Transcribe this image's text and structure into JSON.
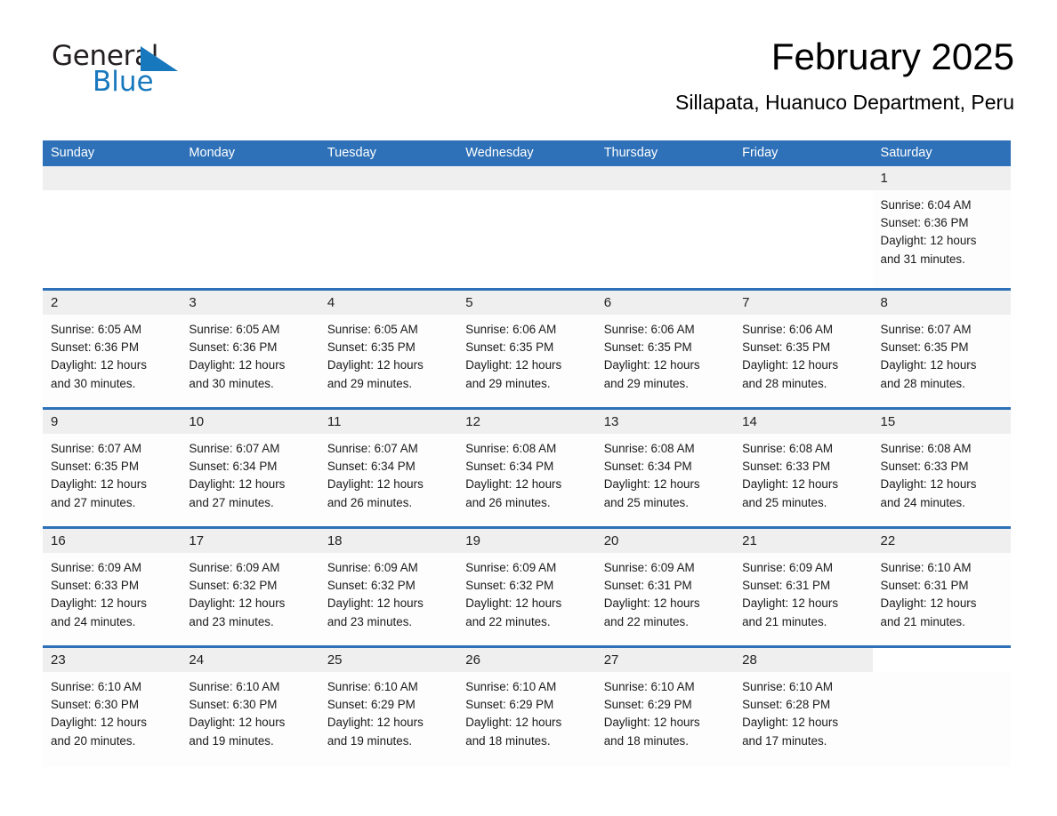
{
  "brand": {
    "name_part1": "General",
    "name_part2": "Blue",
    "accent_color": "#1878be"
  },
  "header": {
    "title": "February 2025",
    "subtitle": "Sillapata, Huanuco Department, Peru"
  },
  "theme": {
    "header_bar_color": "#2e71b8",
    "daynum_band_color": "#efefef",
    "separator_color": "#2e71b8"
  },
  "weekdays": [
    "Sunday",
    "Monday",
    "Tuesday",
    "Wednesday",
    "Thursday",
    "Friday",
    "Saturday"
  ],
  "labels": {
    "sunrise_prefix": "Sunrise:",
    "sunset_prefix": "Sunset:",
    "daylight_prefix": "Daylight:"
  },
  "weeks": [
    [
      {
        "blank": true
      },
      {
        "blank": true
      },
      {
        "blank": true
      },
      {
        "blank": true
      },
      {
        "blank": true
      },
      {
        "blank": true
      },
      {
        "day": "1",
        "sunrise": "Sunrise: 6:04 AM",
        "sunset": "Sunset: 6:36 PM",
        "daylight_l1": "Daylight: 12 hours",
        "daylight_l2": "and 31 minutes."
      }
    ],
    [
      {
        "day": "2",
        "sunrise": "Sunrise: 6:05 AM",
        "sunset": "Sunset: 6:36 PM",
        "daylight_l1": "Daylight: 12 hours",
        "daylight_l2": "and 30 minutes."
      },
      {
        "day": "3",
        "sunrise": "Sunrise: 6:05 AM",
        "sunset": "Sunset: 6:36 PM",
        "daylight_l1": "Daylight: 12 hours",
        "daylight_l2": "and 30 minutes."
      },
      {
        "day": "4",
        "sunrise": "Sunrise: 6:05 AM",
        "sunset": "Sunset: 6:35 PM",
        "daylight_l1": "Daylight: 12 hours",
        "daylight_l2": "and 29 minutes."
      },
      {
        "day": "5",
        "sunrise": "Sunrise: 6:06 AM",
        "sunset": "Sunset: 6:35 PM",
        "daylight_l1": "Daylight: 12 hours",
        "daylight_l2": "and 29 minutes."
      },
      {
        "day": "6",
        "sunrise": "Sunrise: 6:06 AM",
        "sunset": "Sunset: 6:35 PM",
        "daylight_l1": "Daylight: 12 hours",
        "daylight_l2": "and 29 minutes."
      },
      {
        "day": "7",
        "sunrise": "Sunrise: 6:06 AM",
        "sunset": "Sunset: 6:35 PM",
        "daylight_l1": "Daylight: 12 hours",
        "daylight_l2": "and 28 minutes."
      },
      {
        "day": "8",
        "sunrise": "Sunrise: 6:07 AM",
        "sunset": "Sunset: 6:35 PM",
        "daylight_l1": "Daylight: 12 hours",
        "daylight_l2": "and 28 minutes."
      }
    ],
    [
      {
        "day": "9",
        "sunrise": "Sunrise: 6:07 AM",
        "sunset": "Sunset: 6:35 PM",
        "daylight_l1": "Daylight: 12 hours",
        "daylight_l2": "and 27 minutes."
      },
      {
        "day": "10",
        "sunrise": "Sunrise: 6:07 AM",
        "sunset": "Sunset: 6:34 PM",
        "daylight_l1": "Daylight: 12 hours",
        "daylight_l2": "and 27 minutes."
      },
      {
        "day": "11",
        "sunrise": "Sunrise: 6:07 AM",
        "sunset": "Sunset: 6:34 PM",
        "daylight_l1": "Daylight: 12 hours",
        "daylight_l2": "and 26 minutes."
      },
      {
        "day": "12",
        "sunrise": "Sunrise: 6:08 AM",
        "sunset": "Sunset: 6:34 PM",
        "daylight_l1": "Daylight: 12 hours",
        "daylight_l2": "and 26 minutes."
      },
      {
        "day": "13",
        "sunrise": "Sunrise: 6:08 AM",
        "sunset": "Sunset: 6:34 PM",
        "daylight_l1": "Daylight: 12 hours",
        "daylight_l2": "and 25 minutes."
      },
      {
        "day": "14",
        "sunrise": "Sunrise: 6:08 AM",
        "sunset": "Sunset: 6:33 PM",
        "daylight_l1": "Daylight: 12 hours",
        "daylight_l2": "and 25 minutes."
      },
      {
        "day": "15",
        "sunrise": "Sunrise: 6:08 AM",
        "sunset": "Sunset: 6:33 PM",
        "daylight_l1": "Daylight: 12 hours",
        "daylight_l2": "and 24 minutes."
      }
    ],
    [
      {
        "day": "16",
        "sunrise": "Sunrise: 6:09 AM",
        "sunset": "Sunset: 6:33 PM",
        "daylight_l1": "Daylight: 12 hours",
        "daylight_l2": "and 24 minutes."
      },
      {
        "day": "17",
        "sunrise": "Sunrise: 6:09 AM",
        "sunset": "Sunset: 6:32 PM",
        "daylight_l1": "Daylight: 12 hours",
        "daylight_l2": "and 23 minutes."
      },
      {
        "day": "18",
        "sunrise": "Sunrise: 6:09 AM",
        "sunset": "Sunset: 6:32 PM",
        "daylight_l1": "Daylight: 12 hours",
        "daylight_l2": "and 23 minutes."
      },
      {
        "day": "19",
        "sunrise": "Sunrise: 6:09 AM",
        "sunset": "Sunset: 6:32 PM",
        "daylight_l1": "Daylight: 12 hours",
        "daylight_l2": "and 22 minutes."
      },
      {
        "day": "20",
        "sunrise": "Sunrise: 6:09 AM",
        "sunset": "Sunset: 6:31 PM",
        "daylight_l1": "Daylight: 12 hours",
        "daylight_l2": "and 22 minutes."
      },
      {
        "day": "21",
        "sunrise": "Sunrise: 6:09 AM",
        "sunset": "Sunset: 6:31 PM",
        "daylight_l1": "Daylight: 12 hours",
        "daylight_l2": "and 21 minutes."
      },
      {
        "day": "22",
        "sunrise": "Sunrise: 6:10 AM",
        "sunset": "Sunset: 6:31 PM",
        "daylight_l1": "Daylight: 12 hours",
        "daylight_l2": "and 21 minutes."
      }
    ],
    [
      {
        "day": "23",
        "sunrise": "Sunrise: 6:10 AM",
        "sunset": "Sunset: 6:30 PM",
        "daylight_l1": "Daylight: 12 hours",
        "daylight_l2": "and 20 minutes."
      },
      {
        "day": "24",
        "sunrise": "Sunrise: 6:10 AM",
        "sunset": "Sunset: 6:30 PM",
        "daylight_l1": "Daylight: 12 hours",
        "daylight_l2": "and 19 minutes."
      },
      {
        "day": "25",
        "sunrise": "Sunrise: 6:10 AM",
        "sunset": "Sunset: 6:29 PM",
        "daylight_l1": "Daylight: 12 hours",
        "daylight_l2": "and 19 minutes."
      },
      {
        "day": "26",
        "sunrise": "Sunrise: 6:10 AM",
        "sunset": "Sunset: 6:29 PM",
        "daylight_l1": "Daylight: 12 hours",
        "daylight_l2": "and 18 minutes."
      },
      {
        "day": "27",
        "sunrise": "Sunrise: 6:10 AM",
        "sunset": "Sunset: 6:29 PM",
        "daylight_l1": "Daylight: 12 hours",
        "daylight_l2": "and 18 minutes."
      },
      {
        "day": "28",
        "sunrise": "Sunrise: 6:10 AM",
        "sunset": "Sunset: 6:28 PM",
        "daylight_l1": "Daylight: 12 hours",
        "daylight_l2": "and 17 minutes."
      },
      {
        "blank_tail": true
      }
    ]
  ]
}
